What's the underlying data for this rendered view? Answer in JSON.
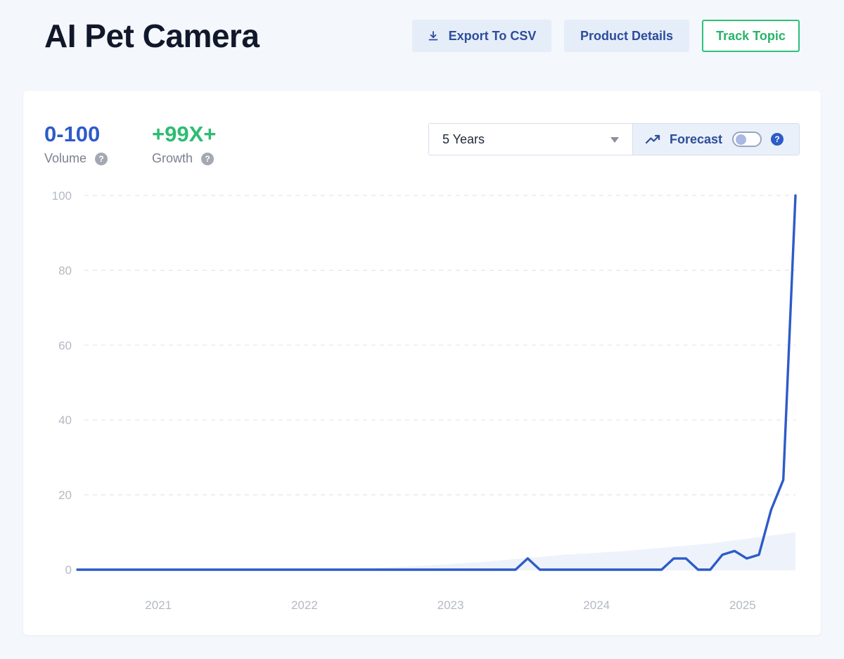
{
  "header": {
    "title": "AI Pet Camera",
    "export_label": "Export To CSV",
    "details_label": "Product Details",
    "track_label": "Track Topic"
  },
  "stats": {
    "volume_value": "0-100",
    "volume_label": "Volume",
    "growth_value": "+99X+",
    "growth_label": "Growth"
  },
  "controls": {
    "range_selected": "5 Years",
    "forecast_label": "Forecast",
    "forecast_enabled": false
  },
  "icons": [
    "download-icon",
    "trend-icon",
    "help-icon",
    "chevron-down-icon"
  ],
  "colors": {
    "line": "#2d5bc8",
    "accent_green": "#2dbd71",
    "area": "#eef3fb"
  },
  "chart_data": {
    "type": "line",
    "title": "",
    "xlabel": "",
    "ylabel": "",
    "ylim": [
      0,
      100
    ],
    "y_ticks": [
      0,
      20,
      40,
      60,
      80,
      100
    ],
    "x_ticks": [
      "2021",
      "2022",
      "2023",
      "2024",
      "2025"
    ],
    "grid": "horizontal-dashed",
    "x_range": [
      "2020-09",
      "2025-08"
    ],
    "series": [
      {
        "points": [
          [
            "2020-09",
            0
          ],
          [
            "2021-06",
            0
          ],
          [
            "2022-03",
            0
          ],
          [
            "2022-12",
            0
          ],
          [
            "2023-09",
            0
          ],
          [
            "2023-10",
            3
          ],
          [
            "2023-11",
            0
          ],
          [
            "2024-03",
            0
          ],
          [
            "2024-09",
            0
          ],
          [
            "2024-10",
            3
          ],
          [
            "2024-11",
            3
          ],
          [
            "2024-12",
            0
          ],
          [
            "2025-01",
            0
          ],
          [
            "2025-02",
            4
          ],
          [
            "2025-03",
            5
          ],
          [
            "2025-04",
            3
          ],
          [
            "2025-05",
            4
          ],
          [
            "2025-06",
            16
          ],
          [
            "2025-07",
            24
          ],
          [
            "2025-08",
            100
          ]
        ]
      }
    ],
    "background_area": [
      [
        "2022-06",
        0
      ],
      [
        "2023-01",
        1
      ],
      [
        "2023-06",
        2
      ],
      [
        "2024-01",
        4
      ],
      [
        "2024-06",
        5
      ],
      [
        "2025-01",
        7
      ],
      [
        "2025-08",
        10
      ]
    ]
  }
}
